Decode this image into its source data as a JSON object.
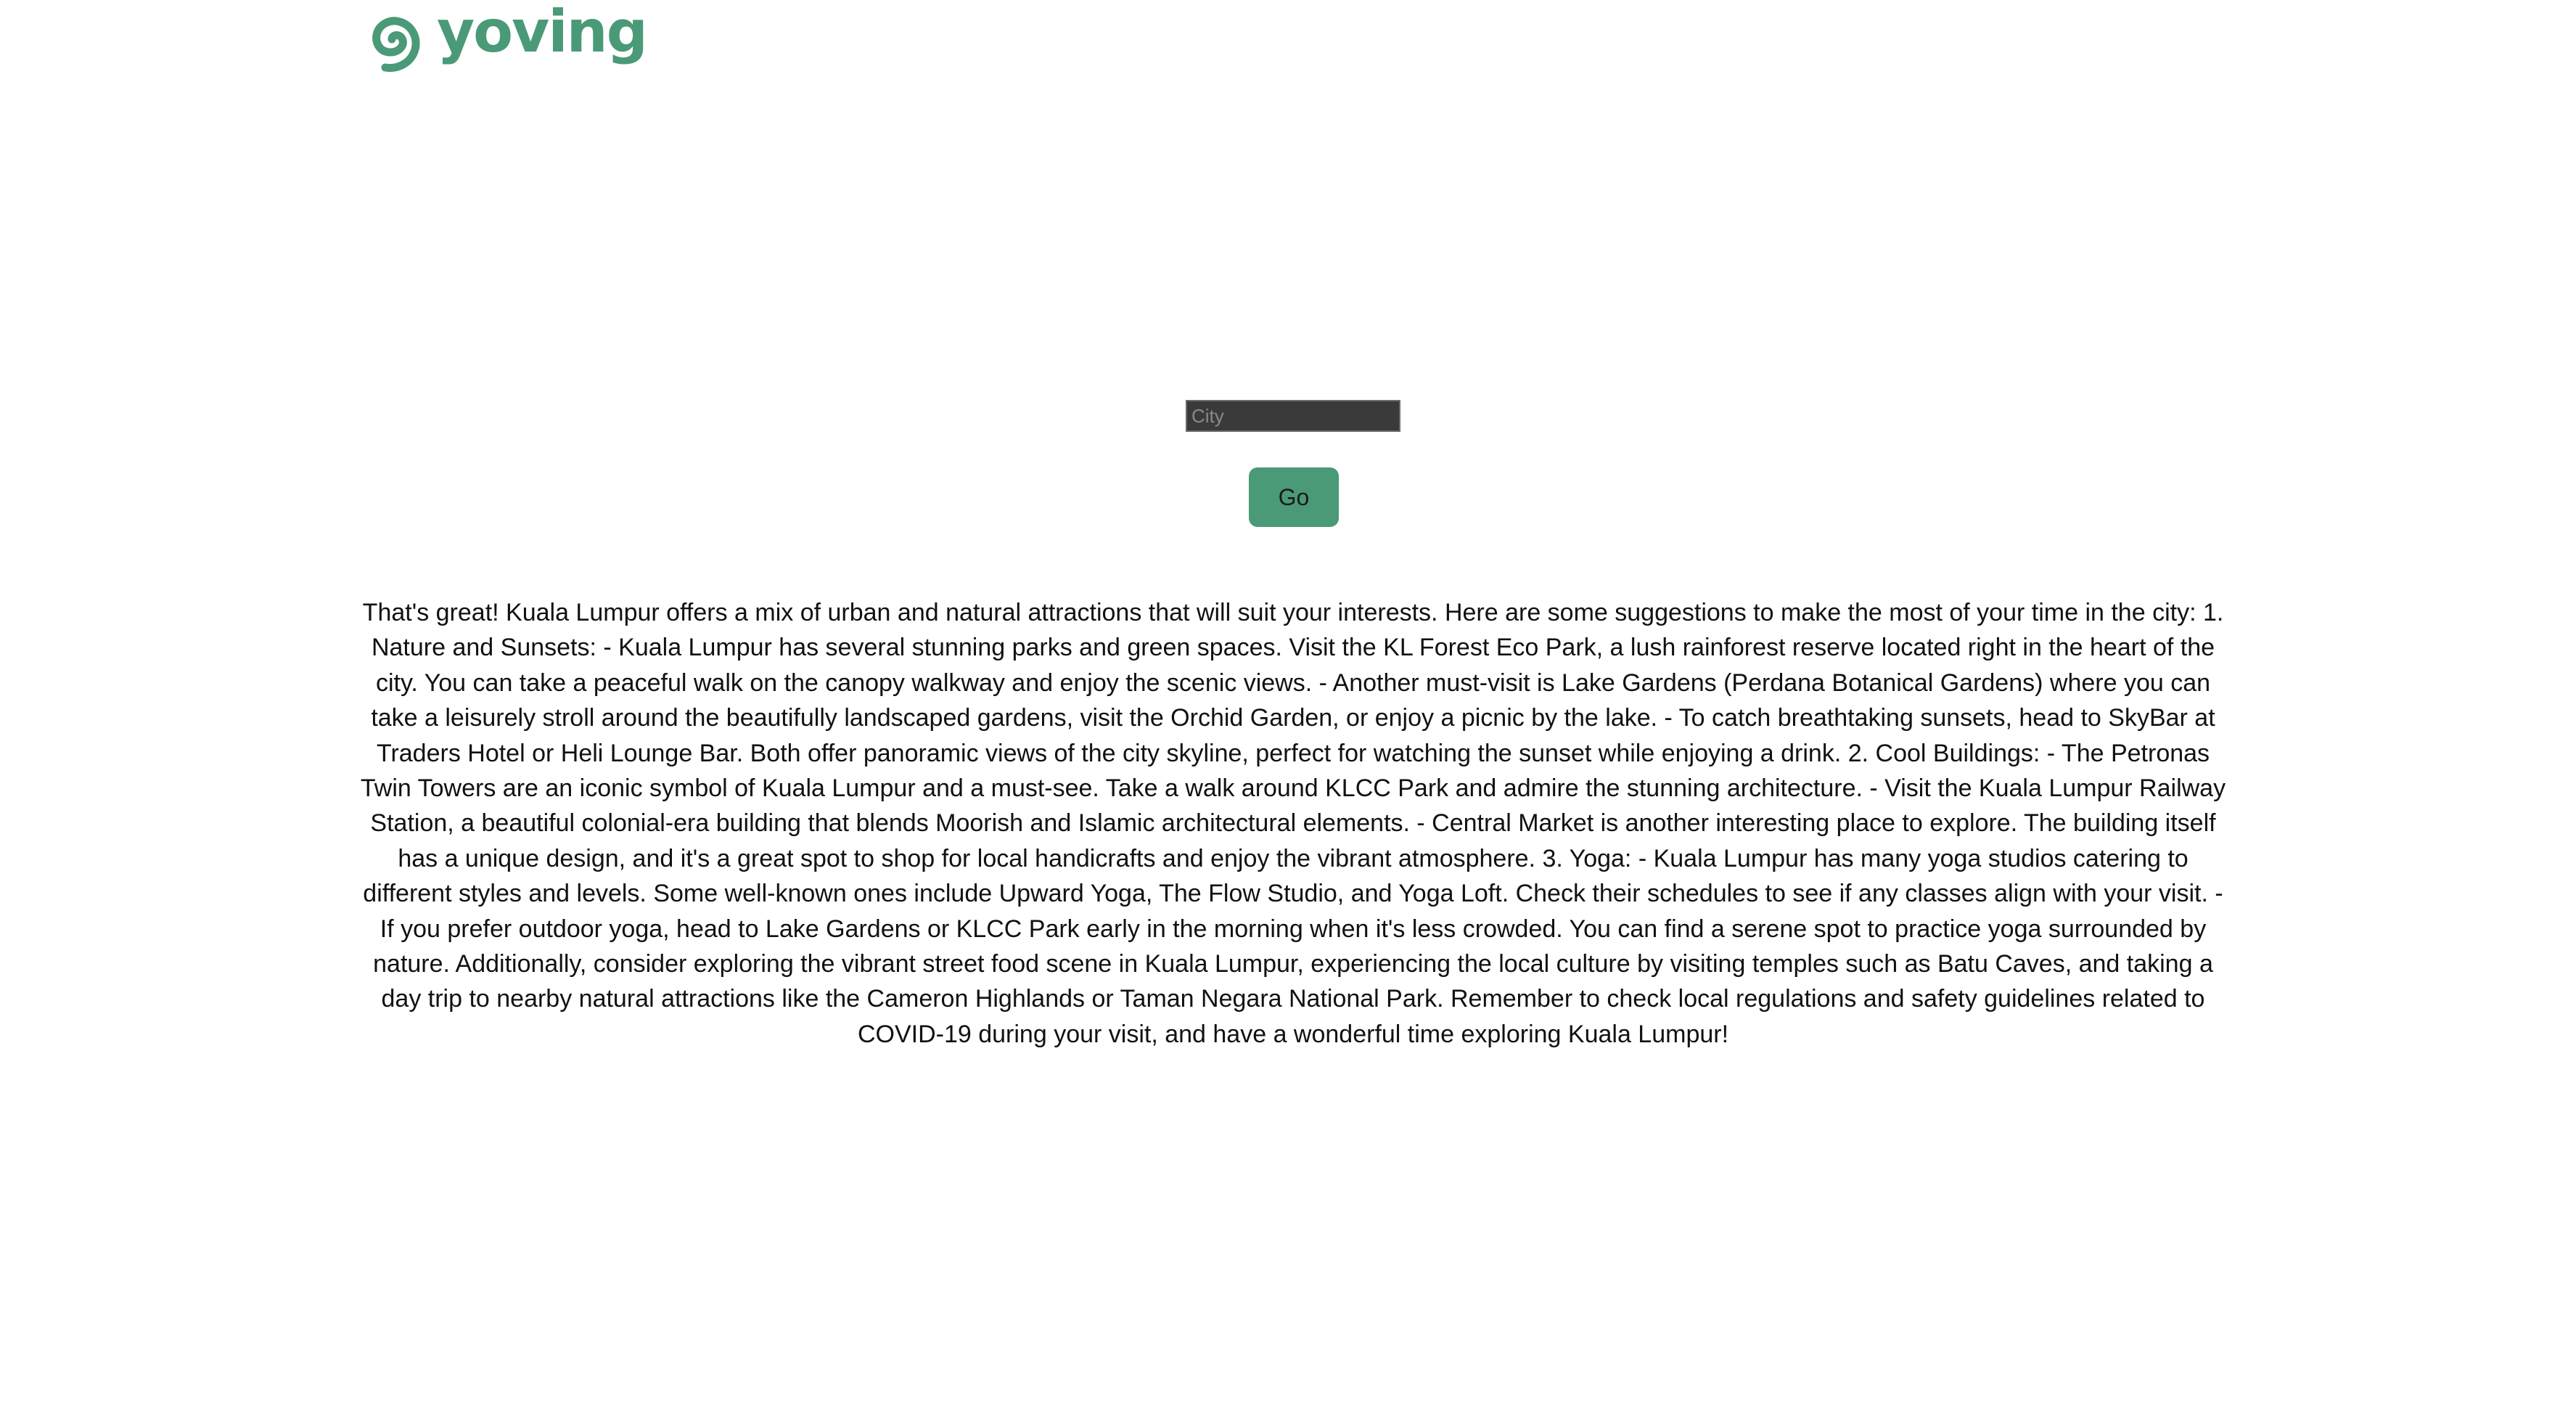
{
  "brand": {
    "name": "yoving",
    "logo_icon": "spiral-logo-icon",
    "color": "#4a9a78"
  },
  "form": {
    "city_placeholder": "City",
    "city_value": "",
    "go_label": "Go"
  },
  "response_text": "That's great! Kuala Lumpur offers a mix of urban and natural attractions that will suit your interests. Here are some suggestions to make the most of your time in the city: 1. Nature and Sunsets: - Kuala Lumpur has several stunning parks and green spaces. Visit the KL Forest Eco Park, a lush rainforest reserve located right in the heart of the city. You can take a peaceful walk on the canopy walkway and enjoy the scenic views. - Another must-visit is Lake Gardens (Perdana Botanical Gardens) where you can take a leisurely stroll around the beautifully landscaped gardens, visit the Orchid Garden, or enjoy a picnic by the lake. - To catch breathtaking sunsets, head to SkyBar at Traders Hotel or Heli Lounge Bar. Both offer panoramic views of the city skyline, perfect for watching the sunset while enjoying a drink. 2. Cool Buildings: - The Petronas Twin Towers are an iconic symbol of Kuala Lumpur and a must-see. Take a walk around KLCC Park and admire the stunning architecture. - Visit the Kuala Lumpur Railway Station, a beautiful colonial-era building that blends Moorish and Islamic architectural elements. - Central Market is another interesting place to explore. The building itself has a unique design, and it's a great spot to shop for local handicrafts and enjoy the vibrant atmosphere. 3. Yoga: - Kuala Lumpur has many yoga studios catering to different styles and levels. Some well-known ones include Upward Yoga, The Flow Studio, and Yoga Loft. Check their schedules to see if any classes align with your visit. - If you prefer outdoor yoga, head to Lake Gardens or KLCC Park early in the morning when it's less crowded. You can find a serene spot to practice yoga surrounded by nature. Additionally, consider exploring the vibrant street food scene in Kuala Lumpur, experiencing the local culture by visiting temples such as Batu Caves, and taking a day trip to nearby natural attractions like the Cameron Highlands or Taman Negara National Park. Remember to check local regulations and safety guidelines related to COVID-19 during your visit, and have a wonderful time exploring Kuala Lumpur!"
}
